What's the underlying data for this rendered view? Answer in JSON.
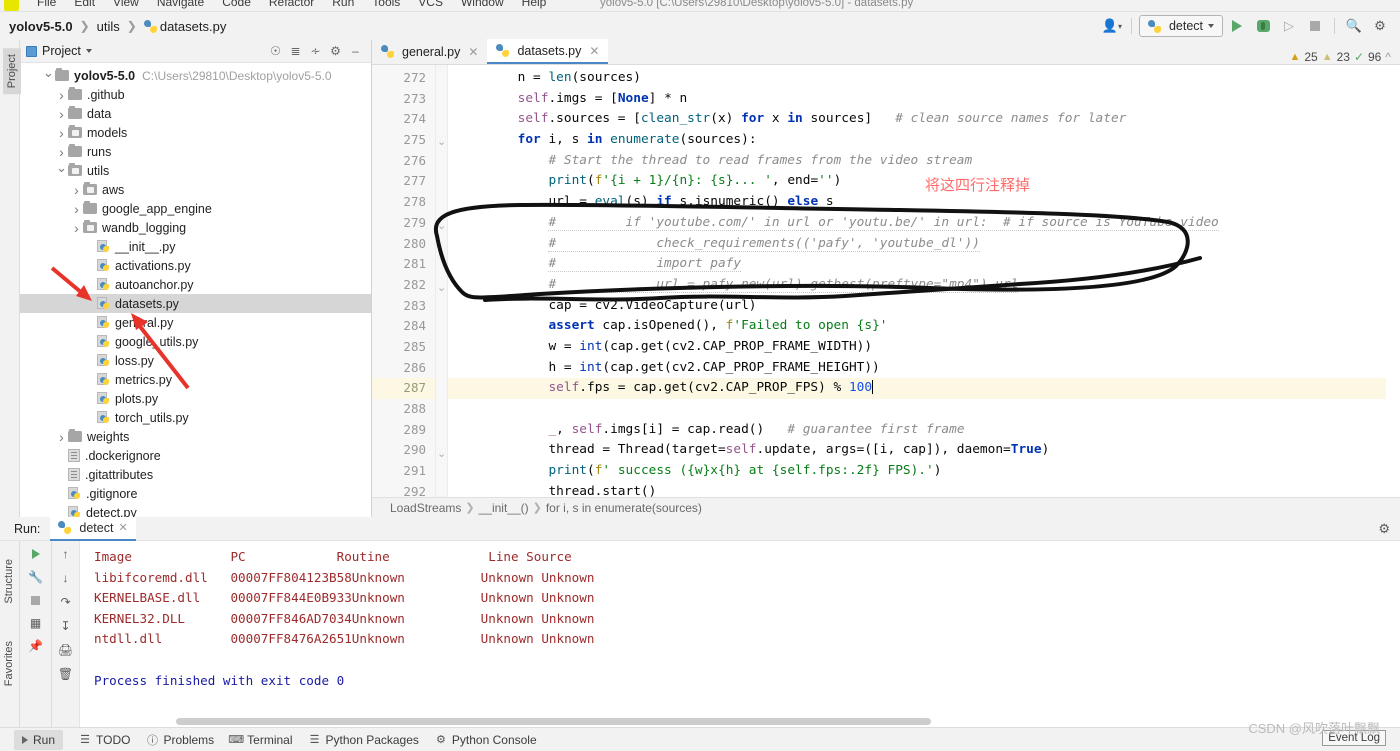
{
  "window": {
    "title": "yolov5-5.0 [C:\\Users\\29810\\Desktop\\yolov5-5.0] - datasets.py",
    "menu": [
      "File",
      "Edit",
      "View",
      "Navigate",
      "Code",
      "Refactor",
      "Run",
      "Tools",
      "VCS",
      "Window",
      "Help"
    ]
  },
  "breadcrumb": {
    "project": "yolov5-5.0",
    "folder": "utils",
    "file": "datasets.py"
  },
  "toolbar": {
    "run_config": "detect",
    "icons": [
      "user-icon",
      "run-icon",
      "debug-icon",
      "run-coverage-icon",
      "stop-icon",
      "search-icon",
      "settings-icon"
    ]
  },
  "project_panel": {
    "title": "Project",
    "vertical_tab": "Project",
    "header_icons": [
      "locate-icon",
      "expand-all-icon",
      "collapse-all-icon",
      "settings-icon",
      "hide-icon"
    ],
    "tree": [
      {
        "label": "yolov5-5.0",
        "path": "C:\\Users\\29810\\Desktop\\yolov5-5.0",
        "indent": 0,
        "icon": "folder",
        "arrow": "down",
        "bold": true
      },
      {
        "label": ".github",
        "indent": 1,
        "icon": "folder",
        "arrow": "right"
      },
      {
        "label": "data",
        "indent": 1,
        "icon": "folder",
        "arrow": "right"
      },
      {
        "label": "models",
        "indent": 1,
        "icon": "folder-module",
        "arrow": "right"
      },
      {
        "label": "runs",
        "indent": 1,
        "icon": "folder",
        "arrow": "right"
      },
      {
        "label": "utils",
        "indent": 1,
        "icon": "folder-module",
        "arrow": "down"
      },
      {
        "label": "aws",
        "indent": 2,
        "icon": "folder-module",
        "arrow": "right"
      },
      {
        "label": "google_app_engine",
        "indent": 2,
        "icon": "folder",
        "arrow": "right"
      },
      {
        "label": "wandb_logging",
        "indent": 2,
        "icon": "folder-module",
        "arrow": "right"
      },
      {
        "label": "__init__.py",
        "indent": 3,
        "icon": "python"
      },
      {
        "label": "activations.py",
        "indent": 3,
        "icon": "python"
      },
      {
        "label": "autoanchor.py",
        "indent": 3,
        "icon": "python"
      },
      {
        "label": "datasets.py",
        "indent": 3,
        "icon": "python",
        "selected": true
      },
      {
        "label": "general.py",
        "indent": 3,
        "icon": "python"
      },
      {
        "label": "google_utils.py",
        "indent": 3,
        "icon": "python"
      },
      {
        "label": "loss.py",
        "indent": 3,
        "icon": "python"
      },
      {
        "label": "metrics.py",
        "indent": 3,
        "icon": "python"
      },
      {
        "label": "plots.py",
        "indent": 3,
        "icon": "python"
      },
      {
        "label": "torch_utils.py",
        "indent": 3,
        "icon": "python"
      },
      {
        "label": "weights",
        "indent": 1,
        "icon": "folder",
        "arrow": "right"
      },
      {
        "label": ".dockerignore",
        "indent": 1,
        "icon": "text"
      },
      {
        "label": ".gitattributes",
        "indent": 1,
        "icon": "text"
      },
      {
        "label": ".gitignore",
        "indent": 1,
        "icon": "python-ignored"
      },
      {
        "label": "detect.py",
        "indent": 1,
        "icon": "python"
      }
    ]
  },
  "editor": {
    "tabs": [
      {
        "label": "general.py",
        "active": false,
        "closable": true
      },
      {
        "label": "datasets.py",
        "active": true,
        "closable": true
      }
    ],
    "inspections": {
      "warnings": "25",
      "weak_warnings": "23",
      "ok": "96"
    },
    "first_line": 272,
    "highlight_line": 287,
    "lines": [
      {
        "n": 272,
        "indent": 8,
        "tokens": [
          [
            "pln",
            "n = "
          ],
          [
            "fn",
            "len"
          ],
          [
            "pln",
            "(sources)"
          ]
        ]
      },
      {
        "n": 273,
        "indent": 8,
        "tokens": [
          [
            "self",
            "self"
          ],
          [
            "pln",
            "."
          ],
          [
            "pln",
            "imgs = ["
          ],
          [
            "kw",
            "None"
          ],
          [
            "pln",
            "] * n"
          ]
        ]
      },
      {
        "n": 274,
        "indent": 8,
        "tokens": [
          [
            "self",
            "self"
          ],
          [
            "pln",
            ".sources = ["
          ],
          [
            "fn",
            "clean_str"
          ],
          [
            "pln",
            "(x) "
          ],
          [
            "kw",
            "for"
          ],
          [
            "pln",
            " x "
          ],
          [
            "kw",
            "in"
          ],
          [
            "pln",
            " sources]   "
          ],
          [
            "cmt",
            "# clean source names for later"
          ]
        ]
      },
      {
        "n": 275,
        "indent": 8,
        "tokens": [
          [
            "kw",
            "for"
          ],
          [
            "pln",
            " i, s "
          ],
          [
            "kw",
            "in"
          ],
          [
            "pln",
            " "
          ],
          [
            "fn",
            "enumerate"
          ],
          [
            "pln",
            "(sources):"
          ]
        ]
      },
      {
        "n": 276,
        "indent": 12,
        "tokens": [
          [
            "cmt",
            "# Start the thread to read frames from the video stream"
          ]
        ]
      },
      {
        "n": 277,
        "indent": 12,
        "tokens": [
          [
            "fn",
            "print"
          ],
          [
            "pln",
            "("
          ],
          [
            "dec",
            "f"
          ],
          [
            "str",
            "'{i + 1}/{n}: {s}... '"
          ],
          [
            "pln",
            ", end="
          ],
          [
            "str",
            "''"
          ],
          [
            "pln",
            ")"
          ]
        ]
      },
      {
        "n": 278,
        "indent": 12,
        "tokens": [
          [
            "pln",
            "url = "
          ],
          [
            "fn",
            "eval"
          ],
          [
            "pln",
            "(s) "
          ],
          [
            "kw",
            "if"
          ],
          [
            "pln",
            " s.isnumeric() "
          ],
          [
            "kw",
            "else"
          ],
          [
            "pln",
            " s"
          ]
        ]
      },
      {
        "n": 279,
        "indent": 12,
        "commented": true,
        "tokens": [
          [
            "cmt",
            "#         if 'youtube.com/' in url or 'youtu.be/' in url:  # if source is YouTube video"
          ]
        ]
      },
      {
        "n": 280,
        "indent": 12,
        "commented": true,
        "tokens": [
          [
            "cmt",
            "#             check_requirements(('pafy', 'youtube_dl'))"
          ]
        ]
      },
      {
        "n": 281,
        "indent": 12,
        "commented": true,
        "tokens": [
          [
            "cmt",
            "#             import pafy"
          ]
        ]
      },
      {
        "n": 282,
        "indent": 12,
        "commented": true,
        "tokens": [
          [
            "cmt",
            "#             url = pafy.new(url).getbest(preftype=\"mp4\").url"
          ]
        ]
      },
      {
        "n": 283,
        "indent": 12,
        "tokens": [
          [
            "pln",
            "cap = cv2.VideoCapture(url)"
          ]
        ]
      },
      {
        "n": 284,
        "indent": 12,
        "tokens": [
          [
            "kw",
            "assert"
          ],
          [
            "pln",
            " cap.isOpened(), "
          ],
          [
            "dec",
            "f"
          ],
          [
            "str",
            "'Failed to open {s}'"
          ]
        ]
      },
      {
        "n": 285,
        "indent": 12,
        "tokens": [
          [
            "pln",
            "w = "
          ],
          [
            "bi",
            "int"
          ],
          [
            "pln",
            "(cap.get(cv2.CAP_PROP_FRAME_WIDTH))"
          ]
        ]
      },
      {
        "n": 286,
        "indent": 12,
        "tokens": [
          [
            "pln",
            "h = "
          ],
          [
            "bi",
            "int"
          ],
          [
            "pln",
            "(cap.get(cv2.CAP_PROP_FRAME_HEIGHT))"
          ]
        ]
      },
      {
        "n": 287,
        "indent": 12,
        "highlight": true,
        "cursor": true,
        "tokens": [
          [
            "self",
            "self"
          ],
          [
            "pln",
            ".fps = cap.get(cv2.CAP_PROP_FPS) % "
          ],
          [
            "num",
            "100"
          ]
        ]
      },
      {
        "n": 288,
        "indent": 0,
        "tokens": [
          [
            "pln",
            ""
          ]
        ]
      },
      {
        "n": 289,
        "indent": 12,
        "tokens": [
          [
            "self",
            "_"
          ],
          [
            "pln",
            ", "
          ],
          [
            "self",
            "self"
          ],
          [
            "pln",
            ".imgs[i] = cap.read()   "
          ],
          [
            "cmt",
            "# guarantee first frame"
          ]
        ]
      },
      {
        "n": 290,
        "indent": 12,
        "tokens": [
          [
            "pln",
            "thread = Thread(target="
          ],
          [
            "self",
            "self"
          ],
          [
            "pln",
            ".update, args=([i, cap]), daemon="
          ],
          [
            "kw",
            "True"
          ],
          [
            "pln",
            ")"
          ]
        ]
      },
      {
        "n": 291,
        "indent": 12,
        "tokens": [
          [
            "fn",
            "print"
          ],
          [
            "pln",
            "("
          ],
          [
            "dec",
            "f"
          ],
          [
            "str",
            "' success ({w}x{h} at {self.fps:.2f} FPS).'"
          ],
          [
            "pln",
            ")"
          ]
        ]
      },
      {
        "n": 292,
        "indent": 12,
        "tokens": [
          [
            "pln",
            "thread.start()"
          ]
        ]
      }
    ],
    "footer_breadcrumb": [
      "LoadStreams",
      "__init__()",
      "for i, s in enumerate(sources)"
    ]
  },
  "annotation": {
    "note": "将这四行注释掉",
    "note_color": "#ff6b6b"
  },
  "run_panel": {
    "label": "Run:",
    "tab": "detect",
    "toolbar_icons": [
      "rerun-icon",
      "stop-icon",
      "pin-icon",
      "print-icon",
      "trash-icon",
      "up-icon",
      "down-icon",
      "soft-wrap-icon",
      "scroll-to-end-icon"
    ],
    "console_table": {
      "headers": [
        "Image",
        "PC",
        "Routine",
        "Line",
        "Source"
      ],
      "rows": [
        [
          "libifcoremd.dll",
          "00007FF804123B58",
          "Unknown",
          "Unknown",
          "Unknown"
        ],
        [
          "KERNELBASE.dll",
          "00007FF844E0B933",
          "Unknown",
          "Unknown",
          "Unknown"
        ],
        [
          "KERNEL32.DLL",
          "00007FF846AD7034",
          "Unknown",
          "Unknown",
          "Unknown"
        ],
        [
          "ntdll.dll",
          "00007FF8476A2651",
          "Unknown",
          "Unknown",
          "Unknown"
        ]
      ]
    },
    "exit_message": "Process finished with exit code 0",
    "vertical_tabs": [
      "Structure",
      "Favorites"
    ]
  },
  "status_bar": {
    "items": [
      {
        "label": "Run",
        "icon": "run-icon",
        "active": true
      },
      {
        "label": "TODO",
        "icon": "todo-icon"
      },
      {
        "label": "Problems",
        "icon": "problems-icon"
      },
      {
        "label": "Terminal",
        "icon": "terminal-icon"
      },
      {
        "label": "Python Packages",
        "icon": "packages-icon"
      },
      {
        "label": "Python Console",
        "icon": "python-console-icon"
      }
    ],
    "event_log": "Event Log"
  },
  "watermark": "CSDN @风吹落叶飘飘"
}
